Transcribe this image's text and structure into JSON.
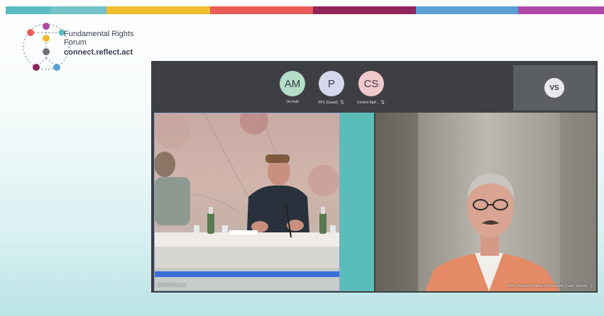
{
  "colors": {
    "stripe": [
      "#5bbdc1",
      "#73c2c6",
      "#f0bd2e",
      "#ec5b57",
      "#92255a",
      "#5aa0d6",
      "#b04aa8"
    ],
    "panel_bg": "#3d3f42",
    "teal_pane": "#5bbdb9",
    "blue_bar": "#3a6fd8"
  },
  "logo": {
    "line1": "Fundamental Rights",
    "line2": "Forum",
    "line3": "connect.reflect.act"
  },
  "roster": [
    {
      "initials": "AM",
      "name": "On hold",
      "color": "#b3dcc9",
      "mic_icon": ""
    },
    {
      "initials": "P",
      "name": "PP1 (Guest)",
      "color": "#d5d7ec",
      "mic_icon": "mic-off-icon"
    },
    {
      "initials": "CS",
      "name": "Control Staf...",
      "color": "#f1c9cd",
      "mic_icon": "mic-off-icon"
    }
  ],
  "mic_glyph": "🎙",
  "vs_tile": {
    "initials": "VS"
  },
  "videos": {
    "left_caption": "MASTER (Guest)",
    "right_caption": "Dan Christian Ghattas (OII Europe) (Cast) (Guest)"
  }
}
